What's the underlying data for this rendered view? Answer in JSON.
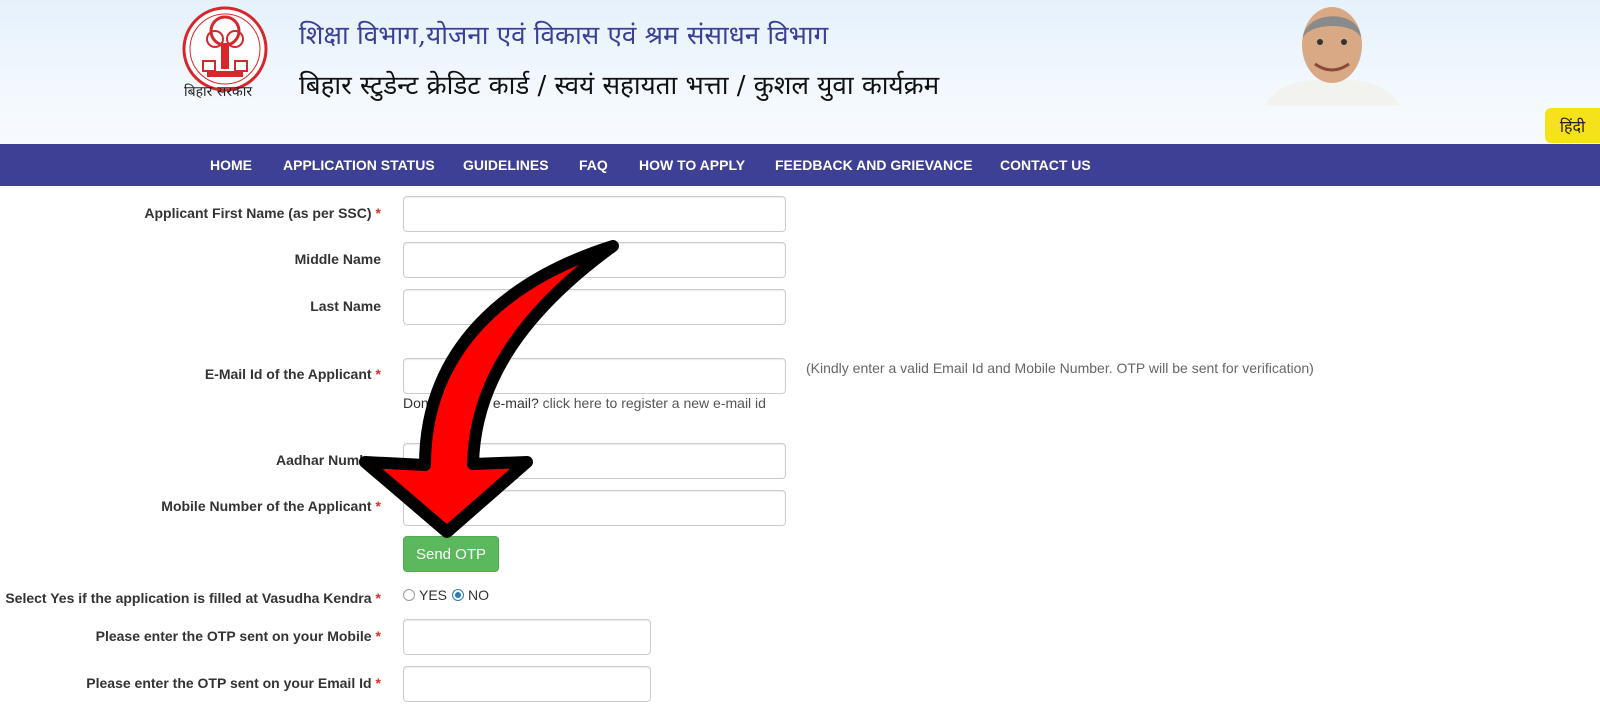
{
  "header": {
    "logo_caption": "बिहार सरकार",
    "department_title": "शिक्षा विभाग,योजना एवं विकास एवं श्रम संसाधन विभाग",
    "scheme_title": "बिहार स्टुडेन्ट क्रेडिट कार्ड / स्वयं सहायता भत्ता / कुशल युवा कार्यक्रम",
    "language_button": "हिंदी"
  },
  "nav": {
    "items": [
      {
        "label": "HOME"
      },
      {
        "label": "APPLICATION STATUS"
      },
      {
        "label": "GUIDELINES"
      },
      {
        "label": "FAQ"
      },
      {
        "label": "HOW TO APPLY"
      },
      {
        "label": "FEEDBACK AND GRIEVANCE"
      },
      {
        "label": "CONTACT US"
      }
    ]
  },
  "form": {
    "first_name_label": "Applicant First Name (as per SSC)",
    "middle_name_label": "Middle Name",
    "last_name_label": "Last Name",
    "email_label": "E-Mail Id of the Applicant",
    "email_hint": "(Kindly enter a valid Email Id and Mobile Number. OTP will be sent for verification)",
    "email_help_prefix": "Don't have an e-mail?",
    "email_help_link": "click here to register a new e-mail id",
    "aadhar_label": "Aadhar Number",
    "mobile_label": "Mobile Number of the Applicant",
    "send_otp_button": "Send OTP",
    "vasudha_label": "Select Yes if the application is filled at Vasudha Kendra",
    "vasudha_options": [
      {
        "label": "YES",
        "selected": false
      },
      {
        "label": "NO",
        "selected": true
      }
    ],
    "mobile_otp_label": "Please enter the OTP sent on your Mobile",
    "email_otp_label": "Please enter the OTP sent on your Email Id",
    "required_marker": "*"
  },
  "colors": {
    "nav_background": "#3d4095",
    "title_blue": "#3d3f96",
    "button_green": "#5cb85c",
    "language_button_yellow": "#f6e21a",
    "arrow_red": "#ff0000",
    "required_red": "#d9302c"
  }
}
